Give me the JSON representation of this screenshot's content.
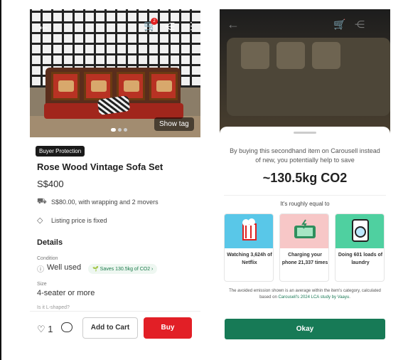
{
  "left": {
    "show_tag": "Show tag",
    "cart_badge": "2",
    "buyer_protection": "Buyer Protection",
    "title": "Rose Wood Vintage Sofa Set",
    "price": "S$400",
    "delivery": "S$80.00, with wrapping and 2 movers",
    "price_fixed": "Listing price is fixed",
    "details_heading": "Details",
    "condition_label": "Condition",
    "condition_value": "Well used",
    "saves_pill": "Saves 130.5kg of CO2",
    "size_label": "Size",
    "size_value": "4-seater or more",
    "lshaped_label": "Is it L-shaped?",
    "like_count": "1",
    "add_to_cart": "Add to Cart",
    "buy": "Buy"
  },
  "right": {
    "intro": "By buying this secondhand item on Carousell instead of new, you potentially help to save",
    "co2": "~130.5kg CO2",
    "equal": "It's roughly equal to",
    "cards": [
      {
        "caption": "Watching 3,624h of Netflix",
        "color": "#59c7e8"
      },
      {
        "caption": "Charging your phone 21,337 times",
        "color": "#f7c7c7"
      },
      {
        "caption": "Doing 601 loads of laundry",
        "color": "#4fd0a0"
      }
    ],
    "note_prefix": "The avoided emission shown is an average within the item's category, calculated based on ",
    "note_link": "Carousell's 2024 LCA study by Vaayu",
    "note_suffix": ".",
    "okay": "Okay"
  }
}
